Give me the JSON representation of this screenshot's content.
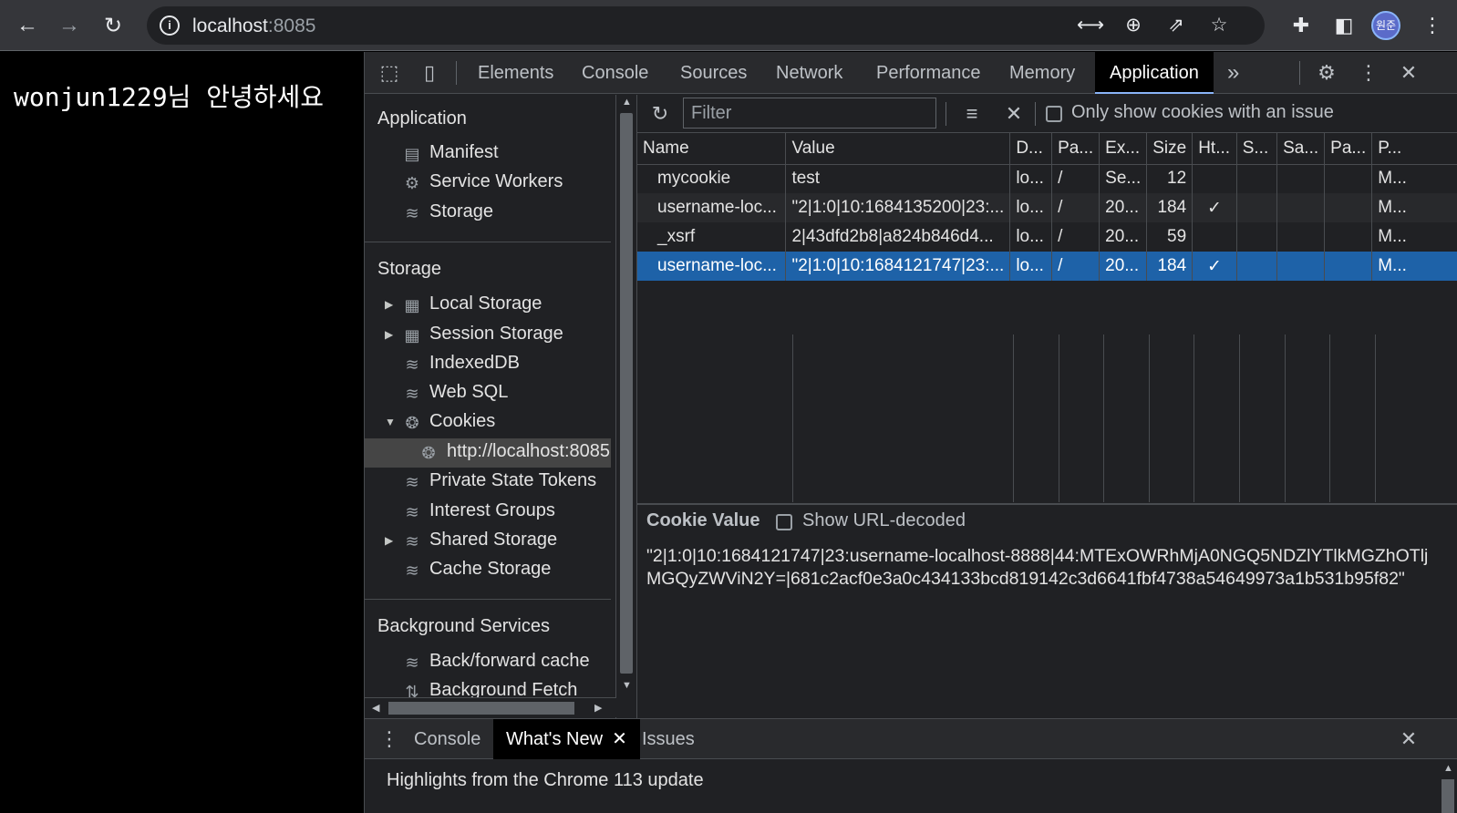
{
  "browser": {
    "url_host": "localhost",
    "url_port": ":8085",
    "avatar_text": "원준",
    "icons": [
      "back-icon",
      "forward-icon",
      "reload-icon",
      "info-icon",
      "translate-icon",
      "zoom-icon",
      "share-icon",
      "star-icon",
      "extensions-icon",
      "side-panel-icon",
      "more-icon"
    ]
  },
  "page": {
    "greeting": "wonjun1229님 안녕하세요"
  },
  "devtools": {
    "tabs": [
      "Elements",
      "Console",
      "Sources",
      "Network",
      "Performance",
      "Memory",
      "Application"
    ],
    "active_tab": "Application",
    "more_tabs": "»",
    "sidebar": {
      "application_header": "Application",
      "application_items": [
        "Manifest",
        "Service Workers",
        "Storage"
      ],
      "storage_header": "Storage",
      "storage_items": [
        "Local Storage",
        "Session Storage",
        "IndexedDB",
        "Web SQL",
        "Cookies"
      ],
      "cookie_origin": "http://localhost:8085",
      "storage_items_2": [
        "Private State Tokens",
        "Interest Groups",
        "Shared Storage",
        "Cache Storage"
      ],
      "background_header": "Background Services",
      "background_items": [
        "Back/forward cache",
        "Background Fetch"
      ]
    },
    "filter": {
      "placeholder": "Filter",
      "only_issue_label": "Only show cookies with an issue"
    },
    "cookie_table": {
      "columns": [
        "Name",
        "Value",
        "D...",
        "Pa...",
        "Ex...",
        "Size",
        "Ht...",
        "S...",
        "Sa...",
        "Pa...",
        "P..."
      ],
      "rows": [
        {
          "name": "mycookie",
          "value": "test",
          "domain": "lo...",
          "path": "/",
          "expires": "Se...",
          "size": "12",
          "http": "",
          "secure": "",
          "samesite": "",
          "partition": "",
          "priority": "M..."
        },
        {
          "name": "username-loc...",
          "value": "\"2|1:0|10:1684135200|23:...",
          "domain": "lo...",
          "path": "/",
          "expires": "20...",
          "size": "184",
          "http": "✓",
          "secure": "",
          "samesite": "",
          "partition": "",
          "priority": "M..."
        },
        {
          "name": "_xsrf",
          "value": "2|43dfd2b8|a824b846d4...",
          "domain": "lo...",
          "path": "/",
          "expires": "20...",
          "size": "59",
          "http": "",
          "secure": "",
          "samesite": "",
          "partition": "",
          "priority": "M..."
        },
        {
          "name": "username-loc...",
          "value": "\"2|1:0|10:1684121747|23:...",
          "domain": "lo...",
          "path": "/",
          "expires": "20...",
          "size": "184",
          "http": "✓",
          "secure": "",
          "samesite": "",
          "partition": "",
          "priority": "M..."
        }
      ],
      "selected_row": 3
    },
    "cookie_value": {
      "title": "Cookie Value",
      "show_decoded_label": "Show URL-decoded",
      "value": "\"2|1:0|10:1684121747|23:username-localhost-8888|44:MTExOWRhMjA0NGQ5NDZlYTlkMGZhOTljMGQyZWViN2Y=|681c2acf0e3a0c434133bcd819142c3d6641fbf4738a54649973a1b531b95f82\""
    },
    "drawer": {
      "tabs": [
        "Console",
        "What's New",
        "Issues"
      ],
      "active_tab": "What's New",
      "content": "Highlights from the Chrome 113 update"
    }
  },
  "colors": {
    "selection": "#1e62a8",
    "accent": "#8ab4f8",
    "panel_bg": "#202124"
  }
}
